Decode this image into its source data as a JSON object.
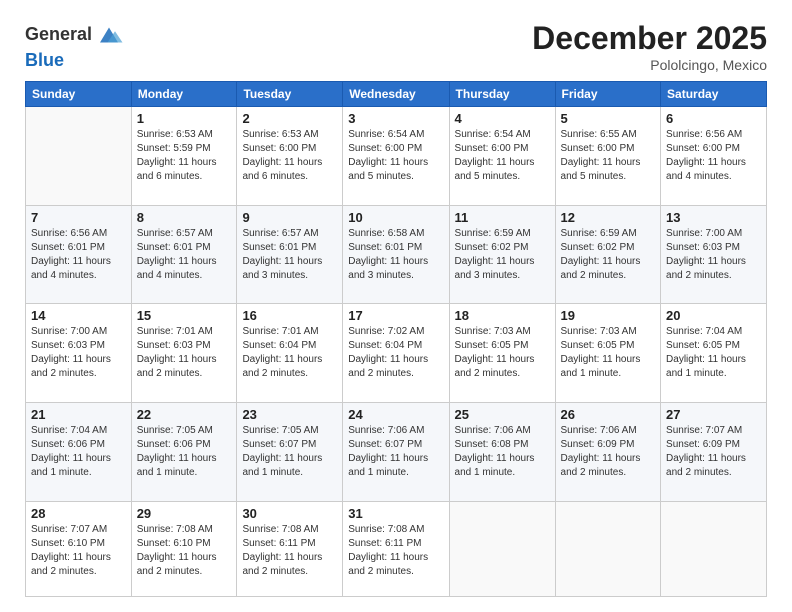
{
  "header": {
    "logo_text_general": "General",
    "logo_text_blue": "Blue",
    "month_title": "December 2025",
    "location": "Pololcingo, Mexico"
  },
  "calendar": {
    "days_of_week": [
      "Sunday",
      "Monday",
      "Tuesday",
      "Wednesday",
      "Thursday",
      "Friday",
      "Saturday"
    ],
    "weeks": [
      [
        {
          "day": "",
          "info": ""
        },
        {
          "day": "1",
          "info": "Sunrise: 6:53 AM\nSunset: 5:59 PM\nDaylight: 11 hours\nand 6 minutes."
        },
        {
          "day": "2",
          "info": "Sunrise: 6:53 AM\nSunset: 6:00 PM\nDaylight: 11 hours\nand 6 minutes."
        },
        {
          "day": "3",
          "info": "Sunrise: 6:54 AM\nSunset: 6:00 PM\nDaylight: 11 hours\nand 5 minutes."
        },
        {
          "day": "4",
          "info": "Sunrise: 6:54 AM\nSunset: 6:00 PM\nDaylight: 11 hours\nand 5 minutes."
        },
        {
          "day": "5",
          "info": "Sunrise: 6:55 AM\nSunset: 6:00 PM\nDaylight: 11 hours\nand 5 minutes."
        },
        {
          "day": "6",
          "info": "Sunrise: 6:56 AM\nSunset: 6:00 PM\nDaylight: 11 hours\nand 4 minutes."
        }
      ],
      [
        {
          "day": "7",
          "info": "Sunrise: 6:56 AM\nSunset: 6:01 PM\nDaylight: 11 hours\nand 4 minutes."
        },
        {
          "day": "8",
          "info": "Sunrise: 6:57 AM\nSunset: 6:01 PM\nDaylight: 11 hours\nand 4 minutes."
        },
        {
          "day": "9",
          "info": "Sunrise: 6:57 AM\nSunset: 6:01 PM\nDaylight: 11 hours\nand 3 minutes."
        },
        {
          "day": "10",
          "info": "Sunrise: 6:58 AM\nSunset: 6:01 PM\nDaylight: 11 hours\nand 3 minutes."
        },
        {
          "day": "11",
          "info": "Sunrise: 6:59 AM\nSunset: 6:02 PM\nDaylight: 11 hours\nand 3 minutes."
        },
        {
          "day": "12",
          "info": "Sunrise: 6:59 AM\nSunset: 6:02 PM\nDaylight: 11 hours\nand 2 minutes."
        },
        {
          "day": "13",
          "info": "Sunrise: 7:00 AM\nSunset: 6:03 PM\nDaylight: 11 hours\nand 2 minutes."
        }
      ],
      [
        {
          "day": "14",
          "info": "Sunrise: 7:00 AM\nSunset: 6:03 PM\nDaylight: 11 hours\nand 2 minutes."
        },
        {
          "day": "15",
          "info": "Sunrise: 7:01 AM\nSunset: 6:03 PM\nDaylight: 11 hours\nand 2 minutes."
        },
        {
          "day": "16",
          "info": "Sunrise: 7:01 AM\nSunset: 6:04 PM\nDaylight: 11 hours\nand 2 minutes."
        },
        {
          "day": "17",
          "info": "Sunrise: 7:02 AM\nSunset: 6:04 PM\nDaylight: 11 hours\nand 2 minutes."
        },
        {
          "day": "18",
          "info": "Sunrise: 7:03 AM\nSunset: 6:05 PM\nDaylight: 11 hours\nand 2 minutes."
        },
        {
          "day": "19",
          "info": "Sunrise: 7:03 AM\nSunset: 6:05 PM\nDaylight: 11 hours\nand 1 minute."
        },
        {
          "day": "20",
          "info": "Sunrise: 7:04 AM\nSunset: 6:05 PM\nDaylight: 11 hours\nand 1 minute."
        }
      ],
      [
        {
          "day": "21",
          "info": "Sunrise: 7:04 AM\nSunset: 6:06 PM\nDaylight: 11 hours\nand 1 minute."
        },
        {
          "day": "22",
          "info": "Sunrise: 7:05 AM\nSunset: 6:06 PM\nDaylight: 11 hours\nand 1 minute."
        },
        {
          "day": "23",
          "info": "Sunrise: 7:05 AM\nSunset: 6:07 PM\nDaylight: 11 hours\nand 1 minute."
        },
        {
          "day": "24",
          "info": "Sunrise: 7:06 AM\nSunset: 6:07 PM\nDaylight: 11 hours\nand 1 minute."
        },
        {
          "day": "25",
          "info": "Sunrise: 7:06 AM\nSunset: 6:08 PM\nDaylight: 11 hours\nand 1 minute."
        },
        {
          "day": "26",
          "info": "Sunrise: 7:06 AM\nSunset: 6:09 PM\nDaylight: 11 hours\nand 2 minutes."
        },
        {
          "day": "27",
          "info": "Sunrise: 7:07 AM\nSunset: 6:09 PM\nDaylight: 11 hours\nand 2 minutes."
        }
      ],
      [
        {
          "day": "28",
          "info": "Sunrise: 7:07 AM\nSunset: 6:10 PM\nDaylight: 11 hours\nand 2 minutes."
        },
        {
          "day": "29",
          "info": "Sunrise: 7:08 AM\nSunset: 6:10 PM\nDaylight: 11 hours\nand 2 minutes."
        },
        {
          "day": "30",
          "info": "Sunrise: 7:08 AM\nSunset: 6:11 PM\nDaylight: 11 hours\nand 2 minutes."
        },
        {
          "day": "31",
          "info": "Sunrise: 7:08 AM\nSunset: 6:11 PM\nDaylight: 11 hours\nand 2 minutes."
        },
        {
          "day": "",
          "info": ""
        },
        {
          "day": "",
          "info": ""
        },
        {
          "day": "",
          "info": ""
        }
      ]
    ]
  }
}
